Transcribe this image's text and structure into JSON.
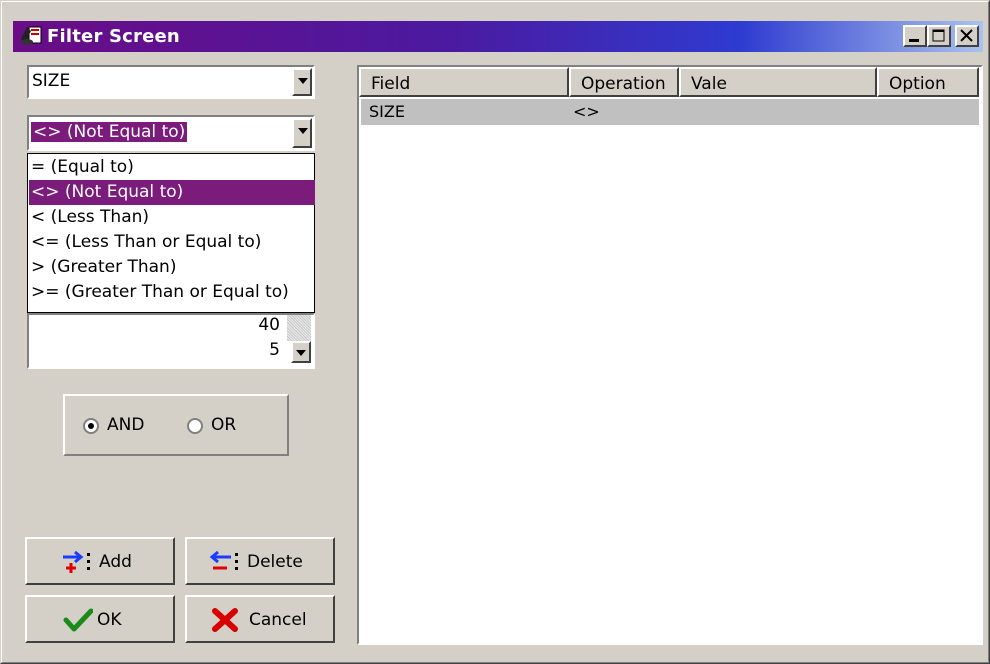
{
  "window": {
    "title": "Filter Screen"
  },
  "field_combo": {
    "value": "SIZE"
  },
  "operation_combo": {
    "value": "<> (Not Equal to)"
  },
  "operation_options": [
    {
      "label": "=   (Equal to)",
      "selected": false
    },
    {
      "label": "<> (Not Equal to)",
      "selected": true
    },
    {
      "label": "<   (Less Than)",
      "selected": false
    },
    {
      "label": "<= (Less Than or Equal to)",
      "selected": false
    },
    {
      "label": ">   (Greater Than)",
      "selected": false
    },
    {
      "label": ">= (Greater Than or Equal to)",
      "selected": false
    }
  ],
  "values_list": [
    "40",
    "5"
  ],
  "logic": {
    "and_label": "AND",
    "or_label": "OR",
    "selected": "AND"
  },
  "buttons": {
    "add": "Add",
    "delete": "Delete",
    "ok": "OK",
    "cancel": "Cancel"
  },
  "grid": {
    "columns": [
      "Field",
      "Operation",
      "Vale",
      "Option"
    ],
    "rows": [
      {
        "field": "SIZE",
        "operation": "<>",
        "value": "",
        "option": ""
      }
    ]
  },
  "colors": {
    "selection": "#7b1c7c",
    "title_start": "#6a0c86",
    "title_end": "#a9c2ee",
    "face": "#d4d0c8"
  }
}
